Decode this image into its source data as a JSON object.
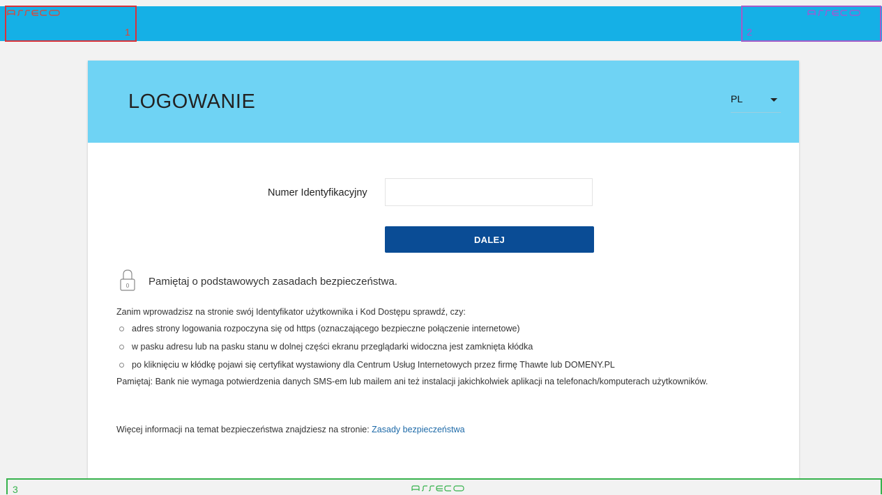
{
  "header": {
    "logo_text": "asseco",
    "box_labels": [
      "1",
      "2",
      "3"
    ],
    "box_colors": [
      "#d9323a",
      "#a45cc8",
      "#37b24d"
    ]
  },
  "login": {
    "title": "LOGOWANIE",
    "language": "PL",
    "field_label": "Numer Identyfikacyjny",
    "field_value": "",
    "submit_label": "DALEJ"
  },
  "security": {
    "heading": "Pamiętaj o podstawowych zasadach bezpieczeństwa.",
    "intro": "Zanim wprowadzisz na stronie swój Identyfikator użytkownika i Kod Dostępu sprawdź, czy:",
    "bullets": [
      "adres strony logowania rozpoczyna się od https (oznaczającego bezpieczne połączenie internetowe)",
      "w pasku adresu lub na pasku stanu w dolnej części ekranu przeglądarki widoczna jest zamknięta kłódka",
      "po kliknięciu w kłódkę pojawi się certyfikat wystawiony dla Centrum Usług Internetowych przez firmę Thawte lub DOMENY.PL"
    ],
    "note": "Pamiętaj: Bank nie wymaga potwierdzenia danych SMS-em lub mailem ani też instalacji jakichkolwiek aplikacji na telefonach/komputerach użytkowników.",
    "more_prefix": "Więcej informacji na temat bezpieczeństwa znajdziesz na stronie:",
    "more_link": "Zasady bezpieczeństwa"
  },
  "colors": {
    "topbar": "#15b0e6",
    "card_header": "#6fd3f4",
    "button": "#0a4c95",
    "link": "#1e6aa8"
  }
}
